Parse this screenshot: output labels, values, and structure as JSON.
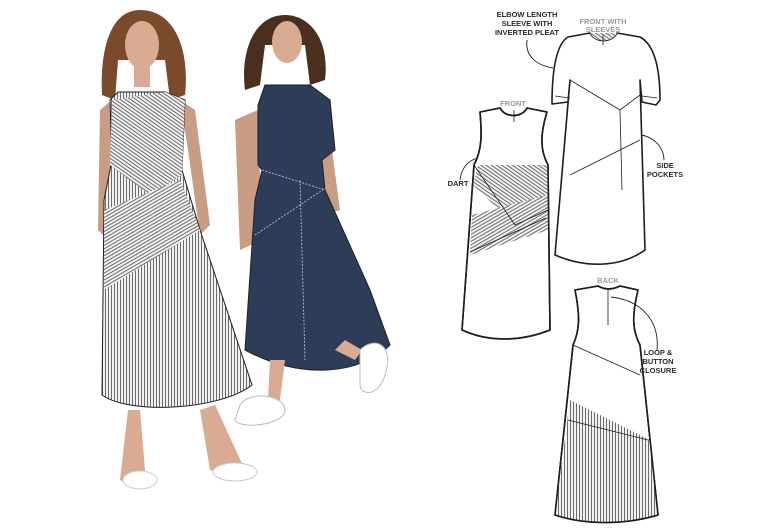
{
  "labels": {
    "sleeve": [
      "ELBOW LENGTH",
      "SLEEVE WITH",
      "INVERTED PLEAT"
    ],
    "front_with_sleeves": [
      "FRONT WITH",
      "SLEEVES"
    ],
    "front": "FRONT",
    "dart": "DART",
    "side_pockets": [
      "SIDE",
      "POCKETS"
    ],
    "back": "BACK",
    "closure": [
      "LOOP &",
      "BUTTON",
      "CLOSURE"
    ]
  },
  "colors": {
    "navy": "#2e3d57",
    "skin": "#d9ab93",
    "hair": "#7a4a2a",
    "stripe": "#6b6b6b"
  }
}
